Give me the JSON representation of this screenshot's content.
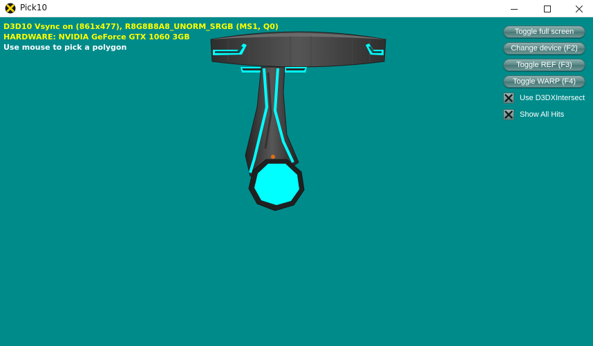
{
  "window": {
    "title": "Pick10",
    "icon": "directx-x-icon",
    "controls": [
      "minimize-icon",
      "maximize-icon",
      "close-icon"
    ]
  },
  "viewport": {
    "background_color": "#008b8b",
    "stats": {
      "line1": "D3D10 Vsync on (861x477), R8G8B8A8_UNORM_SRGB (MS1, Q0)",
      "line2": "HARDWARE: NVIDIA GeForce GTX 1060 3GB",
      "line3": "Use mouse to pick a polygon"
    },
    "colors": {
      "stats_text": "#ffff00",
      "hint_text": "#ffffff",
      "model_accent": "#00ffff",
      "model_body": "#3a3a3a"
    }
  },
  "gui": {
    "buttons": [
      {
        "label": "Toggle full screen"
      },
      {
        "label": "Change device (F2)"
      },
      {
        "label": "Toggle REF (F3)"
      },
      {
        "label": "Toggle WARP (F4)"
      }
    ],
    "checkboxes": [
      {
        "label": "Use D3DXIntersect",
        "checked": true
      },
      {
        "label": "Show All Hits",
        "checked": true
      }
    ]
  }
}
